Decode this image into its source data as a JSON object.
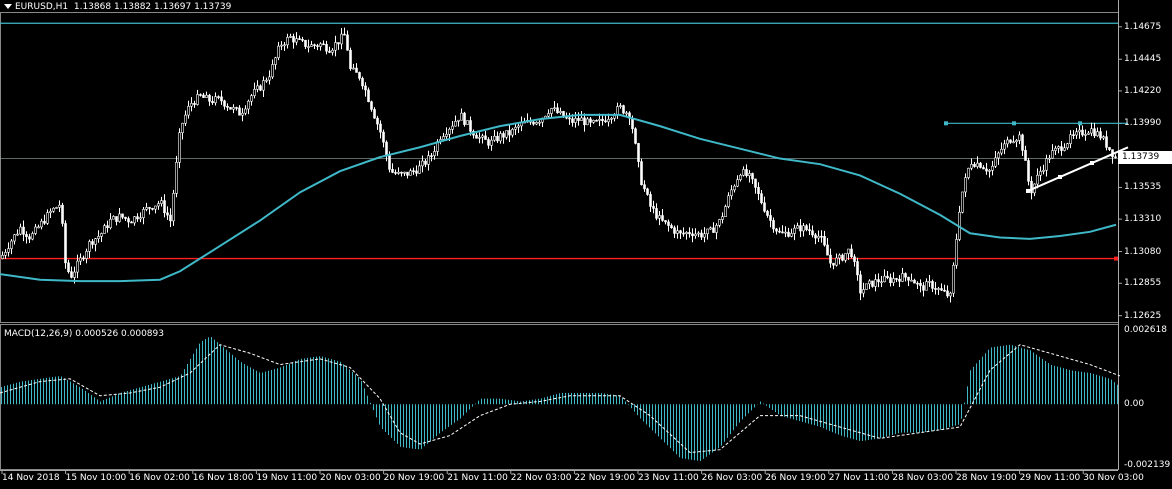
{
  "header": {
    "symbol": "EURUSD,H1",
    "ohlc": "1.13868 1.13882 1.13697 1.13739"
  },
  "macd_header": {
    "name": "MACD(12,26,9)",
    "values": "0.000526 0.000893"
  },
  "current_price": "1.13739",
  "price_axis": [
    "1.14675",
    "1.14445",
    "1.14220",
    "1.13990",
    "1.13535",
    "1.13310",
    "1.13080",
    "1.12855",
    "1.12625"
  ],
  "macd_axis": [
    "0.002618",
    "0.00",
    "-0.002139"
  ],
  "time_axis": [
    "14 Nov 2018",
    "15 Nov 10:00",
    "16 Nov 02:00",
    "16 Nov 18:00",
    "19 Nov 11:00",
    "20 Nov 03:00",
    "20 Nov 19:00",
    "21 Nov 11:00",
    "22 Nov 03:00",
    "22 Nov 19:00",
    "23 Nov 11:00",
    "26 Nov 03:00",
    "26 Nov 19:00",
    "27 Nov 11:00",
    "28 Nov 03:00",
    "28 Nov 19:00",
    "29 Nov 11:00",
    "30 Nov 03:00"
  ],
  "colors": {
    "background": "#000000",
    "candle": "#ffffff",
    "moving_average": "#3fb8c8",
    "horizontal_line": "#3fb8c8",
    "support_line": "#ff2020",
    "trendline": "#ffffff",
    "macd_histogram": "#3fb8c8",
    "macd_signal": "#ffffff",
    "grid": "#3a3a3a"
  },
  "chart_data": {
    "type": "candlestick",
    "symbol": "EURUSD",
    "timeframe": "H1",
    "ylim": [
      1.1258,
      1.1478
    ],
    "close_path": [
      [
        0,
        1.1303
      ],
      [
        10,
        1.1315
      ],
      [
        20,
        1.1325
      ],
      [
        30,
        1.1318
      ],
      [
        40,
        1.1327
      ],
      [
        50,
        1.1336
      ],
      [
        60,
        1.1342
      ],
      [
        65,
        1.13
      ],
      [
        70,
        1.129
      ],
      [
        80,
        1.1302
      ],
      [
        90,
        1.1315
      ],
      [
        100,
        1.132
      ],
      [
        110,
        1.133
      ],
      [
        120,
        1.1333
      ],
      [
        130,
        1.133
      ],
      [
        140,
        1.1335
      ],
      [
        150,
        1.134
      ],
      [
        160,
        1.1343
      ],
      [
        170,
        1.133
      ],
      [
        180,
        1.1396
      ],
      [
        190,
        1.1413
      ],
      [
        200,
        1.1418
      ],
      [
        210,
        1.1415
      ],
      [
        220,
        1.1416
      ],
      [
        230,
        1.141
      ],
      [
        240,
        1.1406
      ],
      [
        250,
        1.1418
      ],
      [
        260,
        1.1425
      ],
      [
        270,
        1.1435
      ],
      [
        280,
        1.1455
      ],
      [
        290,
        1.146
      ],
      [
        300,
        1.1456
      ],
      [
        310,
        1.1454
      ],
      [
        320,
        1.1455
      ],
      [
        330,
        1.1452
      ],
      [
        345,
        1.1462
      ],
      [
        350,
        1.1437
      ],
      [
        360,
        1.1432
      ],
      [
        370,
        1.1413
      ],
      [
        380,
        1.1393
      ],
      [
        390,
        1.1365
      ],
      [
        400,
        1.1362
      ],
      [
        410,
        1.1364
      ],
      [
        420,
        1.1368
      ],
      [
        430,
        1.1375
      ],
      [
        440,
        1.139
      ],
      [
        450,
        1.1397
      ],
      [
        460,
        1.1405
      ],
      [
        470,
        1.1395
      ],
      [
        480,
        1.1388
      ],
      [
        490,
        1.1385
      ],
      [
        500,
        1.139
      ],
      [
        510,
        1.1392
      ],
      [
        520,
        1.1398
      ],
      [
        530,
        1.14
      ],
      [
        540,
        1.1402
      ],
      [
        550,
        1.141
      ],
      [
        560,
        1.1405
      ],
      [
        570,
        1.14
      ],
      [
        580,
        1.1402
      ],
      [
        590,
        1.1398
      ],
      [
        600,
        1.14
      ],
      [
        610,
        1.1405
      ],
      [
        620,
        1.141
      ],
      [
        630,
        1.1405
      ],
      [
        640,
        1.136
      ],
      [
        650,
        1.134
      ],
      [
        660,
        1.133
      ],
      [
        670,
        1.1325
      ],
      [
        680,
        1.132
      ],
      [
        690,
        1.1322
      ],
      [
        700,
        1.132
      ],
      [
        710,
        1.1322
      ],
      [
        720,
        1.133
      ],
      [
        730,
        1.135
      ],
      [
        740,
        1.1365
      ],
      [
        750,
        1.136
      ],
      [
        760,
        1.1345
      ],
      [
        770,
        1.133
      ],
      [
        780,
        1.132
      ],
      [
        790,
        1.1322
      ],
      [
        800,
        1.1325
      ],
      [
        810,
        1.1323
      ],
      [
        820,
        1.1318
      ],
      [
        830,
        1.13
      ],
      [
        840,
        1.1303
      ],
      [
        850,
        1.131
      ],
      [
        860,
        1.128
      ],
      [
        870,
        1.1285
      ],
      [
        880,
        1.1288
      ],
      [
        890,
        1.1288
      ],
      [
        900,
        1.129
      ],
      [
        910,
        1.129
      ],
      [
        920,
        1.1282
      ],
      [
        930,
        1.1285
      ],
      [
        940,
        1.128
      ],
      [
        950,
        1.1276
      ],
      [
        960,
        1.1345
      ],
      [
        970,
        1.1372
      ],
      [
        980,
        1.137
      ],
      [
        990,
        1.1365
      ],
      [
        1000,
        1.138
      ],
      [
        1010,
        1.1388
      ],
      [
        1020,
        1.139
      ],
      [
        1030,
        1.135
      ],
      [
        1040,
        1.1365
      ],
      [
        1050,
        1.1377
      ],
      [
        1060,
        1.1382
      ],
      [
        1070,
        1.1388
      ],
      [
        1080,
        1.1392
      ],
      [
        1090,
        1.1395
      ],
      [
        1100,
        1.139
      ],
      [
        1110,
        1.138
      ],
      [
        1116,
        1.1374
      ]
    ],
    "moving_average": [
      [
        0,
        1.1292
      ],
      [
        40,
        1.1288
      ],
      [
        80,
        1.1287
      ],
      [
        120,
        1.1287
      ],
      [
        160,
        1.1288
      ],
      [
        180,
        1.1294
      ],
      [
        220,
        1.1312
      ],
      [
        260,
        1.133
      ],
      [
        300,
        1.135
      ],
      [
        340,
        1.1365
      ],
      [
        380,
        1.1375
      ],
      [
        420,
        1.1382
      ],
      [
        460,
        1.139
      ],
      [
        500,
        1.1397
      ],
      [
        540,
        1.1402
      ],
      [
        580,
        1.1405
      ],
      [
        620,
        1.1405
      ],
      [
        660,
        1.1397
      ],
      [
        700,
        1.1388
      ],
      [
        740,
        1.1381
      ],
      [
        780,
        1.1374
      ],
      [
        820,
        1.137
      ],
      [
        860,
        1.1362
      ],
      [
        900,
        1.1349
      ],
      [
        940,
        1.1334
      ],
      [
        970,
        1.1321
      ],
      [
        1000,
        1.1318
      ],
      [
        1030,
        1.1317
      ],
      [
        1060,
        1.1319
      ],
      [
        1090,
        1.1322
      ],
      [
        1116,
        1.1327
      ]
    ],
    "horizontal_lines": [
      {
        "price": 1.147
      },
      {
        "price": 1.1399
      },
      {
        "price": 1.1374
      },
      {
        "price": 1.1303
      }
    ],
    "trendline": [
      [
        1028,
        1.1351
      ],
      [
        1128,
        1.1382
      ]
    ],
    "macd": {
      "ylim": [
        -0.002139,
        0.002618
      ],
      "histogram": [
        [
          0,
          0.0006
        ],
        [
          20,
          0.0008
        ],
        [
          40,
          0.0009
        ],
        [
          60,
          0.001
        ],
        [
          80,
          0.0006
        ],
        [
          100,
          0.0001
        ],
        [
          120,
          0.0004
        ],
        [
          140,
          0.0006
        ],
        [
          160,
          0.0008
        ],
        [
          180,
          0.001
        ],
        [
          200,
          0.0022
        ],
        [
          210,
          0.0024
        ],
        [
          220,
          0.0021
        ],
        [
          240,
          0.0015
        ],
        [
          260,
          0.0011
        ],
        [
          280,
          0.0013
        ],
        [
          300,
          0.0016
        ],
        [
          320,
          0.0017
        ],
        [
          340,
          0.0015
        ],
        [
          360,
          0.0009
        ],
        [
          380,
          -0.0008
        ],
        [
          400,
          -0.0015
        ],
        [
          420,
          -0.0016
        ],
        [
          440,
          -0.001
        ],
        [
          460,
          -0.0005
        ],
        [
          480,
          0.0002
        ],
        [
          500,
          0.0002
        ],
        [
          520,
          0.0001
        ],
        [
          540,
          0.0002
        ],
        [
          560,
          0.0004
        ],
        [
          580,
          0.0004
        ],
        [
          600,
          0.0004
        ],
        [
          620,
          0.0003
        ],
        [
          640,
          -0.0005
        ],
        [
          660,
          -0.0012
        ],
        [
          680,
          -0.0019
        ],
        [
          700,
          -0.002
        ],
        [
          720,
          -0.0015
        ],
        [
          740,
          -0.0006
        ],
        [
          760,
          0.0001
        ],
        [
          780,
          -0.0004
        ],
        [
          800,
          -0.0006
        ],
        [
          820,
          -0.0008
        ],
        [
          840,
          -0.0011
        ],
        [
          860,
          -0.0013
        ],
        [
          880,
          -0.0012
        ],
        [
          900,
          -0.001
        ],
        [
          920,
          -0.001
        ],
        [
          940,
          -0.0009
        ],
        [
          960,
          -0.0007
        ],
        [
          970,
          0.0012
        ],
        [
          990,
          0.002
        ],
        [
          1010,
          0.0021
        ],
        [
          1030,
          0.0019
        ],
        [
          1050,
          0.0014
        ],
        [
          1070,
          0.0012
        ],
        [
          1090,
          0.0011
        ],
        [
          1110,
          0.0009
        ],
        [
          1120,
          0.0006
        ]
      ],
      "signal": [
        [
          0,
          0.0004
        ],
        [
          40,
          0.0008
        ],
        [
          70,
          0.0009
        ],
        [
          100,
          0.0003
        ],
        [
          130,
          0.0004
        ],
        [
          160,
          0.0006
        ],
        [
          190,
          0.0011
        ],
        [
          220,
          0.0021
        ],
        [
          250,
          0.0018
        ],
        [
          280,
          0.0014
        ],
        [
          320,
          0.0016
        ],
        [
          350,
          0.0013
        ],
        [
          380,
          0.0002
        ],
        [
          400,
          -0.001
        ],
        [
          420,
          -0.0014
        ],
        [
          450,
          -0.0011
        ],
        [
          480,
          -0.0004
        ],
        [
          510,
          0.0
        ],
        [
          540,
          0.0001
        ],
        [
          570,
          0.0003
        ],
        [
          620,
          0.0003
        ],
        [
          650,
          -0.0004
        ],
        [
          690,
          -0.0017
        ],
        [
          720,
          -0.0016
        ],
        [
          760,
          -0.0004
        ],
        [
          800,
          -0.0004
        ],
        [
          840,
          -0.0008
        ],
        [
          880,
          -0.0012
        ],
        [
          920,
          -0.001
        ],
        [
          960,
          -0.0008
        ],
        [
          990,
          0.0012
        ],
        [
          1020,
          0.0021
        ],
        [
          1050,
          0.0018
        ],
        [
          1090,
          0.0014
        ],
        [
          1120,
          0.001
        ]
      ]
    }
  }
}
